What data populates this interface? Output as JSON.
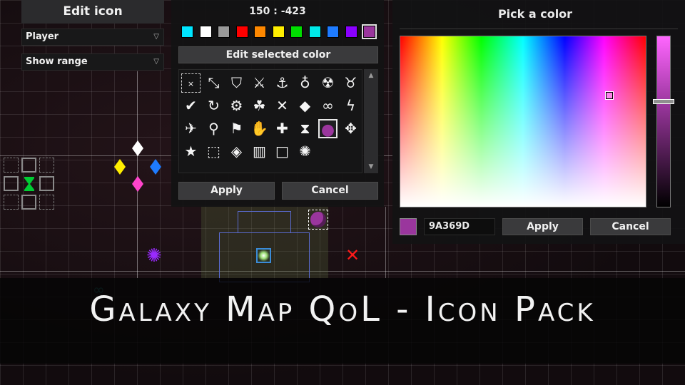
{
  "edit_icon_panel": {
    "title": "Edit icon",
    "owner_select": "Player",
    "range_select": "Show range"
  },
  "icon_editor": {
    "coordinates": "150 : -423",
    "palette": [
      {
        "name": "cyan",
        "hex": "#00e5ff"
      },
      {
        "name": "white",
        "hex": "#ffffff"
      },
      {
        "name": "gray",
        "hex": "#9a9a9a"
      },
      {
        "name": "red",
        "hex": "#ff0000"
      },
      {
        "name": "orange",
        "hex": "#ff8800"
      },
      {
        "name": "yellow",
        "hex": "#ffee00"
      },
      {
        "name": "green",
        "hex": "#00dd00"
      },
      {
        "name": "teal",
        "hex": "#00e8e8"
      },
      {
        "name": "blue",
        "hex": "#1e7bff"
      },
      {
        "name": "violet",
        "hex": "#8a00ff"
      },
      {
        "name": "purple",
        "hex": "#9a369d",
        "selected": true
      }
    ],
    "edit_color_label": "Edit selected color",
    "icons": [
      {
        "name": "none-icon",
        "glyph": "×"
      },
      {
        "name": "shrink-arrows-icon",
        "glyph": "⤡"
      },
      {
        "name": "shield-badge-icon",
        "glyph": "⛉"
      },
      {
        "name": "crossed-swords-icon",
        "glyph": "⚔"
      },
      {
        "name": "anchor-icon",
        "glyph": "⚓"
      },
      {
        "name": "money-bag-icon",
        "glyph": "♁"
      },
      {
        "name": "bug-icon",
        "glyph": "☢"
      },
      {
        "name": "bull-skull-icon",
        "glyph": "♉"
      },
      {
        "name": "checkmark-icon",
        "glyph": "✔"
      },
      {
        "name": "refresh-icon",
        "glyph": "↻"
      },
      {
        "name": "gear-icon",
        "glyph": "⚙"
      },
      {
        "name": "group-icon",
        "glyph": "☘"
      },
      {
        "name": "cross-x-icon",
        "glyph": "✕"
      },
      {
        "name": "diamond-icon",
        "glyph": "◆"
      },
      {
        "name": "mask-icon",
        "glyph": "∞"
      },
      {
        "name": "lightning-icon",
        "glyph": "ϟ"
      },
      {
        "name": "spaceship-icon",
        "glyph": "✈"
      },
      {
        "name": "map-pin-icon",
        "glyph": "⚲"
      },
      {
        "name": "flags-icon",
        "glyph": "⚑"
      },
      {
        "name": "hand-icon",
        "glyph": "✋"
      },
      {
        "name": "plus-icon",
        "glyph": "✚"
      },
      {
        "name": "hourglass-icon",
        "glyph": "⧗"
      },
      {
        "name": "planet-icon",
        "glyph": "●",
        "selected": true
      },
      {
        "name": "move-arrows-icon",
        "glyph": "✥"
      },
      {
        "name": "star-icon",
        "glyph": "★"
      },
      {
        "name": "dashed-square-icon",
        "glyph": "⬚"
      },
      {
        "name": "shield-icon",
        "glyph": "◈"
      },
      {
        "name": "trash-icon",
        "glyph": "▥"
      },
      {
        "name": "square-icon",
        "glyph": "□"
      },
      {
        "name": "vortex-icon",
        "glyph": "✺"
      }
    ],
    "apply_label": "Apply",
    "cancel_label": "Cancel"
  },
  "color_picker": {
    "title": "Pick a color",
    "hex_value": "9A369D",
    "preview_color": "#9a369d",
    "apply_label": "Apply",
    "cancel_label": "Cancel"
  },
  "map": {
    "diamond_colors": {
      "top": "#ffffff",
      "left": "#ffee00",
      "right": "#1e7bff",
      "bottom": "#ff44cc"
    },
    "hourglass_color": "#00cc33",
    "x_mark_color": "#ff1a1a",
    "vortex_color": "#9a2aff",
    "planet_color": "#9a369d",
    "mask_color": "#1f6f72"
  },
  "banner": {
    "text": "Galaxy Map QoL - Icon Pack"
  }
}
